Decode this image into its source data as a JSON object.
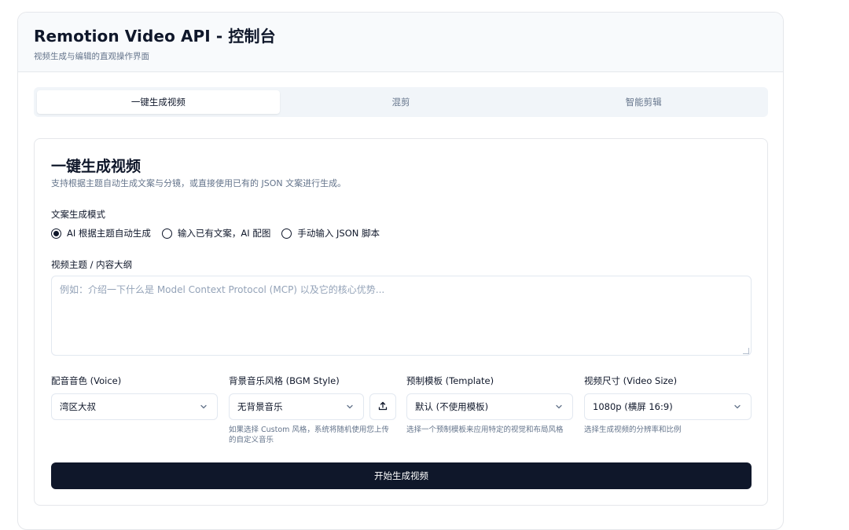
{
  "header": {
    "title": "Remotion Video API - 控制台",
    "subtitle": "视频生成与编辑的直观操作界面"
  },
  "tabs": [
    {
      "label": "一键生成视频",
      "active": true
    },
    {
      "label": "混剪",
      "active": false
    },
    {
      "label": "智能剪辑",
      "active": false
    }
  ],
  "section": {
    "title": "一键生成视频",
    "description": "支持根据主题自动生成文案与分镜，或直接使用已有的 JSON 文案进行生成。"
  },
  "mode": {
    "label": "文案生成模式",
    "options": [
      {
        "label": "AI 根据主题自动生成",
        "selected": true
      },
      {
        "label": "输入已有文案，AI 配图",
        "selected": false
      },
      {
        "label": "手动输入 JSON 脚本",
        "selected": false
      }
    ]
  },
  "topic": {
    "label": "视频主题 / 内容大纲",
    "placeholder": "例如：介绍一下什么是 Model Context Protocol (MCP) 以及它的核心优势...",
    "value": ""
  },
  "voice": {
    "label": "配音音色 (Voice)",
    "value": "湾区大叔"
  },
  "bgm": {
    "label": "背景音乐风格 (BGM Style)",
    "value": "无背景音乐",
    "hint": "如果选择 Custom 风格，系统将随机使用您上传的自定义音乐"
  },
  "template": {
    "label": "预制模板 (Template)",
    "value": "默认 (不使用模板)",
    "hint": "选择一个预制模板来应用特定的视觉和布局风格"
  },
  "size": {
    "label": "视频尺寸 (Video Size)",
    "value": "1080p (横屏 16:9)",
    "hint": "选择生成视频的分辨率和比例"
  },
  "submit_label": "开始生成视频",
  "colors": {
    "primary": "#0f172a",
    "muted": "#64748b",
    "border": "#e2e8f0",
    "tab_bg": "#f1f5f9"
  }
}
